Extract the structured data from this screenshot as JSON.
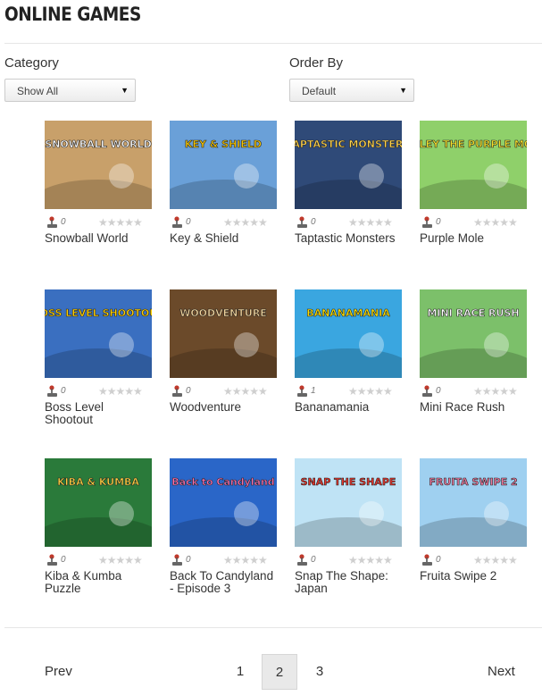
{
  "page_title": "ONLINE GAMES",
  "filters": {
    "category": {
      "label": "Category",
      "selected": "Show All"
    },
    "order_by": {
      "label": "Order By",
      "selected": "Default"
    }
  },
  "games": [
    {
      "name": "Snowball World",
      "plays": "0",
      "bg": "#c8a06a",
      "art": "SNOWBALL WORLD",
      "art_color": "#fff"
    },
    {
      "name": "Key & Shield",
      "plays": "0",
      "bg": "#6aa0d8",
      "art": "KEY & SHIELD",
      "art_color": "#f5c400"
    },
    {
      "name": "Taptastic Monsters",
      "plays": "0",
      "bg": "#2f4a78",
      "art": "TAPTASTIC MONSTERS",
      "art_color": "#ffd24a"
    },
    {
      "name": "Purple Mole",
      "plays": "0",
      "bg": "#8fd06a",
      "art": "MOLEY THE PURPLE MOLE",
      "art_color": "#f5e02a"
    },
    {
      "name": "Boss Level Shootout",
      "plays": "0",
      "bg": "#3a6fc0",
      "art": "BOSS LEVEL SHOOTOUT",
      "art_color": "#ffd000"
    },
    {
      "name": "Woodventure",
      "plays": "0",
      "bg": "#6b4a2a",
      "art": "WOODVENTURE",
      "art_color": "#f0d29a"
    },
    {
      "name": "Bananamania",
      "plays": "1",
      "bg": "#3aa6e0",
      "art": "BANANAMANIA",
      "art_color": "#ffe000"
    },
    {
      "name": "Mini Race Rush",
      "plays": "0",
      "bg": "#7cc06a",
      "art": "MINI RACE RUSH",
      "art_color": "#ffffff"
    },
    {
      "name": "Kiba & Kumba Puzzle",
      "plays": "0",
      "bg": "#2a7a3a",
      "art": "KIBA & KUMBA",
      "art_color": "#ffd040"
    },
    {
      "name": "Back To Candyland - Episode 3",
      "plays": "0",
      "bg": "#2a66c8",
      "art": "Back to Candyland",
      "art_color": "#ff6fb0"
    },
    {
      "name": "Snap The Shape: Japan",
      "plays": "0",
      "bg": "#bfe3f5",
      "art": "SNAP THE SHAPE",
      "art_color": "#e8342a"
    },
    {
      "name": "Fruita Swipe 2",
      "plays": "0",
      "bg": "#9fd0f0",
      "art": "FRUITA SWIPE 2",
      "art_color": "#f07aa0"
    }
  ],
  "pagination": {
    "prev": "Prev",
    "next": "Next",
    "pages": [
      "1",
      "2",
      "3"
    ],
    "current": "2"
  },
  "icons": {
    "plays": "joystick-icon",
    "rating": "star-rating-icon",
    "select_arrow": "triangle-down-icon"
  }
}
